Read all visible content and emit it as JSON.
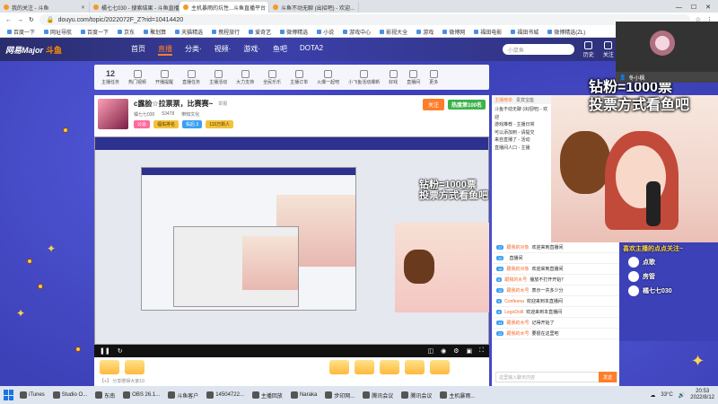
{
  "browser": {
    "tabs": [
      {
        "label": "我的关注 - 斗鱼"
      },
      {
        "label": "橘七七030 - 搜索结果 - 斗鱼直播"
      },
      {
        "label": "主机暴雨的坑性...斗鱼直播平台"
      },
      {
        "label": "斗鱼不动无聊 (出招吧) - 欢迎..."
      }
    ],
    "address": "douyu.com/topic/2022072F_Z?rid=10414420",
    "bookmarks": [
      "百度一下",
      "网址导航",
      "百度一下",
      "京东",
      "聚划算",
      "天猫精选",
      "携程旅行",
      "爱奇艺",
      "微博精选",
      "小说",
      "游戏中心",
      "影视大全",
      "游戏",
      "微博网",
      "福田电影",
      "福田书城",
      "微博精选(ZL)"
    ]
  },
  "sitenav": {
    "logo": "网易Major",
    "logo_sub": "斗鱼",
    "items": [
      "首页",
      "直播",
      "分类·",
      "视频·",
      "游戏·",
      "鱼吧",
      "DOTA2"
    ],
    "search_placeholder": "小鼠鱼",
    "right_items": [
      "历史",
      "关注",
      "创作",
      "消息",
      "活动",
      "下载",
      "开播"
    ],
    "pc_button": "PC客户端"
  },
  "categories": {
    "num": "12",
    "num_label": "主播任务",
    "items": [
      "热门视频",
      "开播提醒",
      "直播任务",
      "主播活动",
      "大力支持",
      "全民乐乐",
      "主播订单",
      "火爆一起吧",
      "小飞鱼活动爆新",
      "好戏",
      "直播间",
      "更多"
    ]
  },
  "room": {
    "title": "c露脸☆拉票票，比赛赛~",
    "tag": "举报",
    "meta1": "橘七七030",
    "meta2": "53478",
    "meta3": "带知文化",
    "follow": "关注",
    "rank": "热度第100名",
    "badges": [
      "公会",
      "福佑排名",
      "佑后 3",
      "115万新人"
    ]
  },
  "nested_overlay": {
    "line1": "钻粉=1000票",
    "line2": "投票方式看鱼吧"
  },
  "chat_panel": {
    "tabs": [
      "主播榜单",
      "贵宾宝座",
      "粉丝团"
    ],
    "notice": "斗鱼不动无聊 (出招吧) - 欢迎",
    "lines": [
      "游戏推荐 - 主播日常",
      "可以添加到 - 请提交",
      "来自直播了 - 活动",
      "直播间人口 - 主播"
    ]
  },
  "overlay": {
    "line1": "钻粉=1000票",
    "line2": "投票方式看鱼吧"
  },
  "viewer": {
    "name": "冬小枫"
  },
  "follow_card": {
    "title": "喜欢主播的点点关注~",
    "items": [
      "点歌",
      "房管",
      "橘七七030"
    ]
  },
  "chat_messages": [
    {
      "lv": "17",
      "name": "跟我的对象",
      "text": "欢迎来到直播间"
    },
    {
      "lv": "12",
      "name": "",
      "text": "直播间"
    },
    {
      "lv": "16",
      "name": "跟我的对象",
      "text": "欢迎来到直播间"
    },
    {
      "lv": "8",
      "name": "跟我的水号",
      "text": "播放不打开开始？"
    },
    {
      "lv": "12",
      "name": "跟我的水号",
      "text": "表示一共多少分"
    },
    {
      "lv": "9",
      "name": "Confeena",
      "text": "欢迎来到本直播间"
    },
    {
      "lv": "8",
      "name": "LegoDolll",
      "text": "欢迎来到本直播间"
    },
    {
      "lv": "14",
      "name": "跟我的水号",
      "text": "记得开始了"
    },
    {
      "lv": "12",
      "name": "跟我的水号",
      "text": "要很在这里吧"
    }
  ],
  "chat_input_placeholder": "这里输入聊天内容",
  "send_label": "发送",
  "gift_note": "【+】 分享赠得大家10",
  "taskbar": {
    "apps": [
      "iTunes",
      "Studio O...",
      "东南",
      "OBS 26.1...",
      "斗鱼客户",
      "14504722...",
      "主播回放",
      "Naraka",
      "步印网...",
      "腾讯会议",
      "腾讯会议",
      "主机暴雨..."
    ],
    "weather": "33°C",
    "time": "20:53",
    "date": "2022/8/12"
  }
}
